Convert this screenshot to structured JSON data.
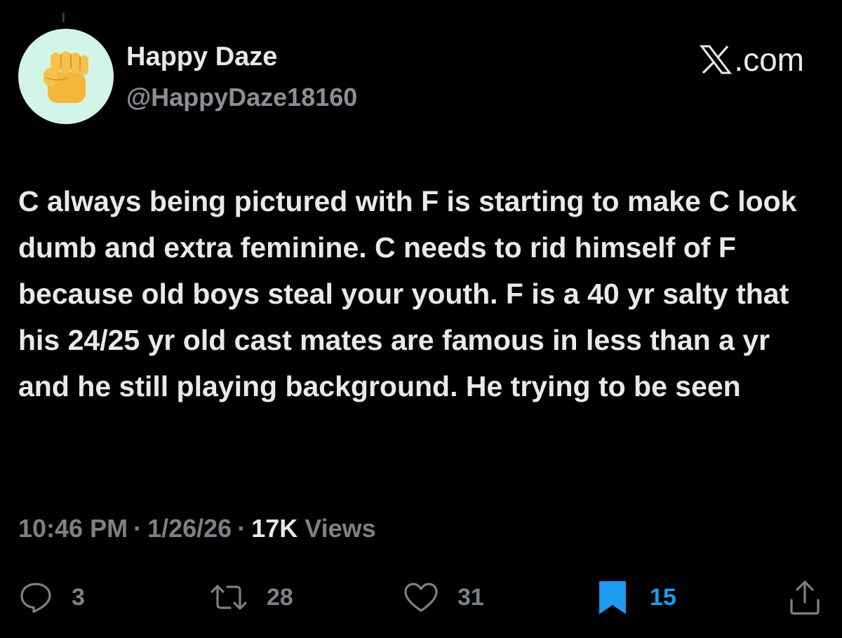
{
  "author": {
    "display_name": "Happy Daze",
    "handle": "@HappyDaze18160",
    "avatar_icon": "raised-fist-emoji",
    "avatar_bg": "#d3f5e7"
  },
  "brand": {
    "logo_icon": "x-logo",
    "suffix": ".com"
  },
  "tweet": {
    "text": "C always being pictured with F is starting to make C look dumb and extra feminine. C needs to rid himself of F because old boys steal your youth. F is a 40 yr salty that his 24/25 yr old cast mates are famous in less than a yr and he still playing background. He trying to be seen"
  },
  "meta": {
    "time": "10:46 PM",
    "separator": "·",
    "date": "1/26/26",
    "views_count": "17K",
    "views_label": "Views"
  },
  "actions": {
    "reply": {
      "icon": "reply-icon",
      "count": "3"
    },
    "repost": {
      "icon": "repost-icon",
      "count": "28"
    },
    "like": {
      "icon": "heart-icon",
      "count": "31"
    },
    "bookmark": {
      "icon": "bookmark-icon",
      "count": "15",
      "active": true,
      "color": "#1d9bf0"
    },
    "share": {
      "icon": "share-icon"
    }
  },
  "colors": {
    "background": "#000000",
    "primary_text": "#e7e9ea",
    "secondary_text": "#7c8187",
    "accent": "#1d9bf0"
  }
}
